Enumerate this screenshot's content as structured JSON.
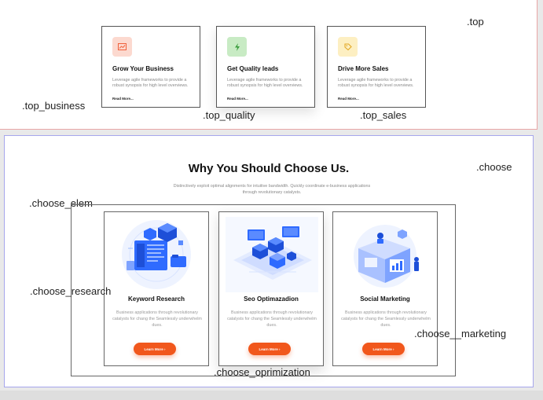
{
  "top": {
    "section_label": ".top",
    "cards": [
      {
        "label": ".top_business",
        "title": "Grow Your Business",
        "text": "Leverage agile frameworks to provide a robust synopsis for high level overviews.",
        "link": "Read More...",
        "icon": "chart-icon",
        "icon_bg": "#fcd9cf",
        "icon_color": "#f0603b"
      },
      {
        "label": ".top_quality",
        "title": "Get Quality leads",
        "text": "Leverage agile frameworks to provide a robust synopsis for high level overviews.",
        "link": "Read More...",
        "icon": "bolt-icon",
        "icon_bg": "#c8ebc4",
        "icon_color": "#3a9d3d"
      },
      {
        "label": ".top_sales",
        "title": "Drive More Sales",
        "text": "Leverage agile frameworks to provide a robust synopsis for high level overviews.",
        "link": "Read More...",
        "icon": "tag-icon",
        "icon_bg": "#fdefc2",
        "icon_color": "#e3a928"
      }
    ]
  },
  "choose": {
    "section_label": ".choose",
    "elem_label": ".choose_elem",
    "title": "Why You Should Choose Us.",
    "subtitle": "Distinctively exploit optimal alignments for intuitive bandwidth. Quickly coordinate e-business applications through revolutionary catalysts.",
    "cards": [
      {
        "label": ".choose_research",
        "title": "Keyword Research",
        "text": "Business applications through revolutionary catalysts for chang the Seamlessly underwhelm dues.",
        "button": "Learn More ›",
        "illustration": "keyword-research-illustration"
      },
      {
        "label": ".choose_oprimization",
        "title": "Seo Optimazadion",
        "text": "Business applications through revolutionary catalysts for chang the Seamlessly underwhelm dues.",
        "button": "Learn More ›",
        "illustration": "seo-optimization-illustration"
      },
      {
        "label": ".choose__marketing",
        "title": "Social Marketing",
        "text": "Business applications through revolutionary catalysts for chang the Seamlessly underwhelm dues.",
        "button": "Learn More ›",
        "illustration": "social-marketing-illustration"
      }
    ]
  },
  "colors": {
    "accent": "#f1571c",
    "top_border": "#e9a6a6",
    "choose_border": "#a6a6ec",
    "illustration_blue": "#2f6bff"
  }
}
